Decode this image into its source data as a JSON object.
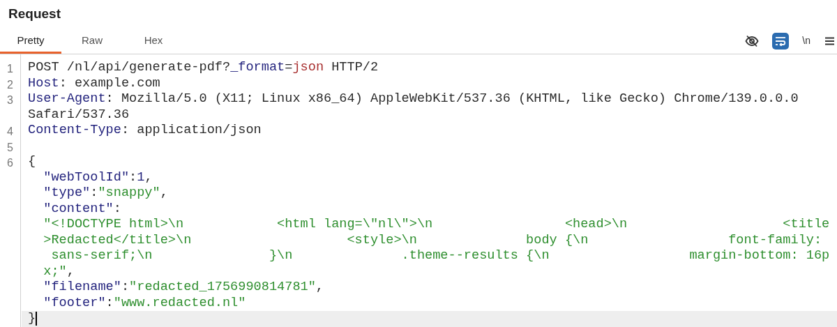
{
  "title": "Request",
  "tabs": [
    {
      "label": "Pretty",
      "selected": true
    },
    {
      "label": "Raw",
      "selected": false
    },
    {
      "label": "Hex",
      "selected": false
    }
  ],
  "toolbar": [
    {
      "kind": "hide",
      "on": false
    },
    {
      "kind": "wrap",
      "on": true
    },
    {
      "kind": "text",
      "label": "\\n",
      "on": false
    },
    {
      "kind": "menu"
    }
  ],
  "lines": [
    {
      "number": "1",
      "rows": [
        {
          "tokens": [
            {
              "t": "POST /nl/api/generate-pdf?",
              "kind": "plain"
            },
            {
              "t": "_format",
              "kind": "name"
            },
            {
              "t": "=",
              "kind": "plain"
            },
            {
              "t": "json",
              "kind": "param"
            },
            {
              "t": " HTTP/2",
              "kind": "plain"
            }
          ]
        }
      ]
    },
    {
      "number": "2",
      "rows": [
        {
          "tokens": [
            {
              "t": "Host",
              "kind": "name"
            },
            {
              "t": ": example.com",
              "kind": "plain"
            }
          ]
        }
      ]
    },
    {
      "number": "3",
      "rows": [
        {
          "tokens": [
            {
              "t": "User-Agent",
              "kind": "name"
            },
            {
              "t": ": Mozilla/5.0 (X11; Linux x86_64) AppleWebKit/537.36 (KHTML, like Gecko) Chrome/139.0.0.0",
              "kind": "plain"
            }
          ]
        },
        {
          "tokens": [
            {
              "t": "Safari/537.36",
              "kind": "plain"
            }
          ]
        }
      ]
    },
    {
      "number": "4",
      "rows": [
        {
          "tokens": [
            {
              "t": "Content-Type",
              "kind": "name"
            },
            {
              "t": ": application/json",
              "kind": "plain"
            }
          ]
        }
      ]
    },
    {
      "number": "5",
      "rows": [
        {
          "tokens": []
        }
      ]
    },
    {
      "number": "6",
      "rows": [
        {
          "tokens": [
            {
              "t": "{",
              "kind": "plain"
            }
          ]
        },
        {
          "indented": true,
          "tokens": [
            {
              "t": "\"webToolId\"",
              "kind": "name"
            },
            {
              "t": ":",
              "kind": "plain"
            },
            {
              "t": "1",
              "kind": "name"
            },
            {
              "t": ",",
              "kind": "plain"
            }
          ]
        },
        {
          "indented": true,
          "tokens": [
            {
              "t": "\"type\"",
              "kind": "name"
            },
            {
              "t": ":",
              "kind": "plain"
            },
            {
              "t": "\"snappy\"",
              "kind": "value"
            },
            {
              "t": ",",
              "kind": "plain"
            }
          ]
        },
        {
          "indented": true,
          "tokens": [
            {
              "t": "\"content\"",
              "kind": "name"
            },
            {
              "t": ":",
              "kind": "plain"
            }
          ]
        },
        {
          "indented": true,
          "tokens": [
            {
              "t": "\"<!DOCTYPE html>\\n            <html lang=\\\"nl\\\">\\n                 <head>\\n                    <title",
              "kind": "value"
            }
          ]
        },
        {
          "indented": true,
          "tokens": [
            {
              "t": ">Redacted</title>\\n                    <style>\\n              body {\\n                  font-family:",
              "kind": "value"
            }
          ]
        },
        {
          "indented": true,
          "tokens": [
            {
              "t": " sans-serif;\\n               }\\n              .theme--results {\\n                  margin-bottom: 16p",
              "kind": "value"
            }
          ]
        },
        {
          "indented": true,
          "tokens": [
            {
              "t": "x;\"",
              "kind": "value"
            },
            {
              "t": ",",
              "kind": "plain"
            }
          ]
        },
        {
          "indented": true,
          "tokens": [
            {
              "t": "\"filename\"",
              "kind": "name"
            },
            {
              "t": ":",
              "kind": "plain"
            },
            {
              "t": "\"redacted_1756990814781\"",
              "kind": "value"
            },
            {
              "t": ",",
              "kind": "plain"
            }
          ]
        },
        {
          "indented": true,
          "tokens": [
            {
              "t": "\"footer\"",
              "kind": "name"
            },
            {
              "t": ":",
              "kind": "plain"
            },
            {
              "t": "\"www.redacted.nl\"",
              "kind": "value"
            }
          ]
        },
        {
          "current": true,
          "tokens": [
            {
              "t": "}",
              "kind": "plain"
            }
          ]
        }
      ]
    }
  ]
}
